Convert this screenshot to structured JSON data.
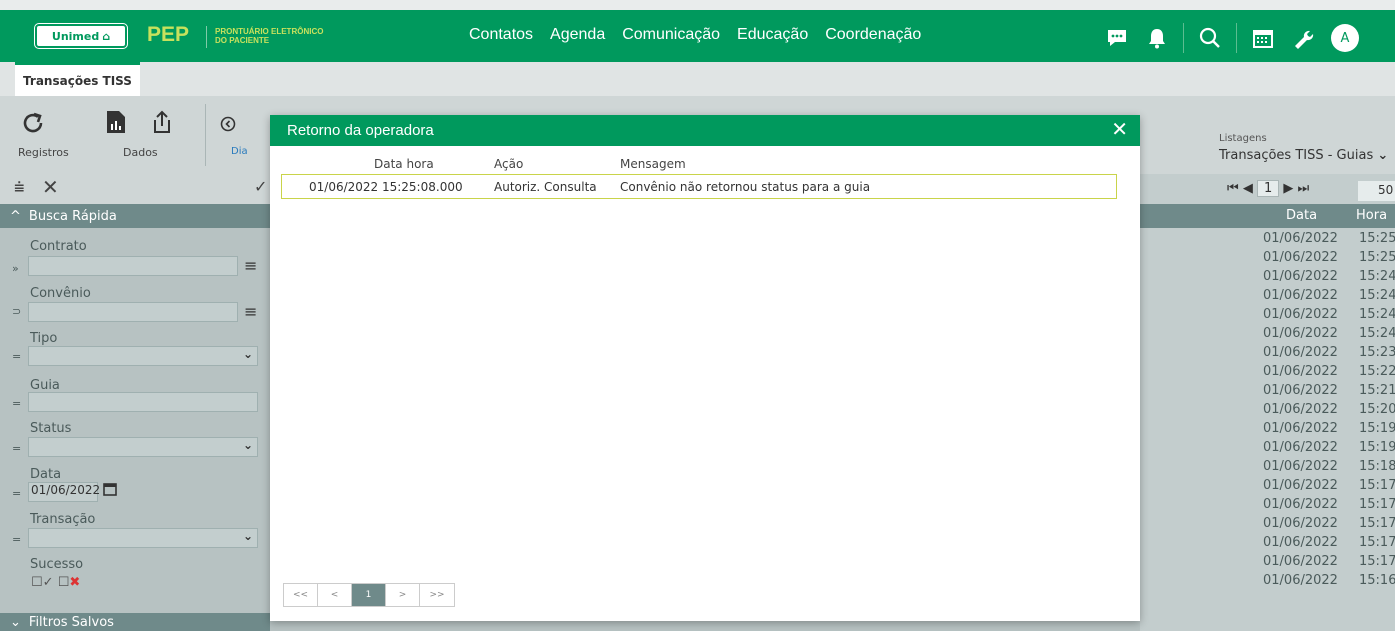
{
  "header": {
    "logo": "Unimed",
    "app": "PEP",
    "subtitle_line1": "PRONTUÁRIO ELETRÔNICO",
    "subtitle_line2": "DO PACIENTE",
    "nav": [
      "Contatos",
      "Agenda",
      "Comunicação",
      "Educação",
      "Coordenação"
    ],
    "avatar": "A"
  },
  "tabs": [
    "Transações TISS"
  ],
  "toolbar": {
    "registros": "Registros",
    "dados": "Dados",
    "dia": "Dia",
    "listagens_label": "Listagens",
    "listagens_value": "Transações TISS - Guias",
    "page": "1",
    "page_size": "50"
  },
  "filters": {
    "busca_rapida": "Busca Rápida",
    "contrato": "Contrato",
    "convenio": "Convênio",
    "tipo": "Tipo",
    "guia": "Guia",
    "status": "Status",
    "data": "Data",
    "data_value": "01/06/2022",
    "transacao": "Transação",
    "sucesso": "Sucesso",
    "filtros_salvos": "Filtros Salvos"
  },
  "grid": {
    "col_data": "Data",
    "col_hora": "Hora",
    "rows": [
      [
        "01/06/2022",
        "15:25:"
      ],
      [
        "01/06/2022",
        "15:25:"
      ],
      [
        "01/06/2022",
        "15:24:"
      ],
      [
        "01/06/2022",
        "15:24:"
      ],
      [
        "01/06/2022",
        "15:24:"
      ],
      [
        "01/06/2022",
        "15:24:"
      ],
      [
        "01/06/2022",
        "15:23:"
      ],
      [
        "01/06/2022",
        "15:22:"
      ],
      [
        "01/06/2022",
        "15:21:"
      ],
      [
        "01/06/2022",
        "15:20:"
      ],
      [
        "01/06/2022",
        "15:19:"
      ],
      [
        "01/06/2022",
        "15:19:"
      ],
      [
        "01/06/2022",
        "15:18:"
      ],
      [
        "01/06/2022",
        "15:17:"
      ],
      [
        "01/06/2022",
        "15:17:"
      ],
      [
        "01/06/2022",
        "15:17:"
      ],
      [
        "01/06/2022",
        "15:17:"
      ],
      [
        "01/06/2022",
        "15:17:"
      ],
      [
        "01/06/2022",
        "15:16:"
      ]
    ]
  },
  "modal": {
    "title": "Retorno da operadora",
    "col_datahora": "Data hora",
    "col_acao": "Ação",
    "col_mensagem": "Mensagem",
    "row": {
      "datahora": "01/06/2022 15:25:08.000",
      "acao": "Autoriz. Consulta",
      "mensagem": "Convênio não retornou status para a guia"
    },
    "pager": [
      "<<",
      "<",
      "1",
      ">",
      ">>"
    ]
  }
}
